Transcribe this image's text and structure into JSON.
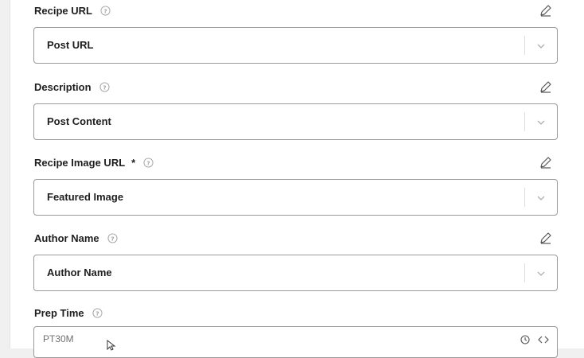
{
  "fields": [
    {
      "label": "Recipe URL",
      "value": "Post URL",
      "required": false
    },
    {
      "label": "Description",
      "value": "Post Content",
      "required": false
    },
    {
      "label": "Recipe Image URL",
      "value": "Featured Image",
      "required": true,
      "required_mark": "*"
    },
    {
      "label": "Author Name",
      "value": "Author Name",
      "required": false
    }
  ],
  "prep_time": {
    "label": "Prep Time",
    "value": "PT30M"
  },
  "icons": {
    "help": "question-circle-icon",
    "edit": "pencil-icon",
    "dropdown": "chevron-down-icon",
    "clock": "clock-icon",
    "code": "code-brackets-icon"
  },
  "colors": {
    "page_background": "#f0f0f1",
    "panel_background": "#ffffff",
    "label_text": "#1e1e1e",
    "border": "#9a9a9a",
    "muted_icon": "#a0a0a0"
  }
}
